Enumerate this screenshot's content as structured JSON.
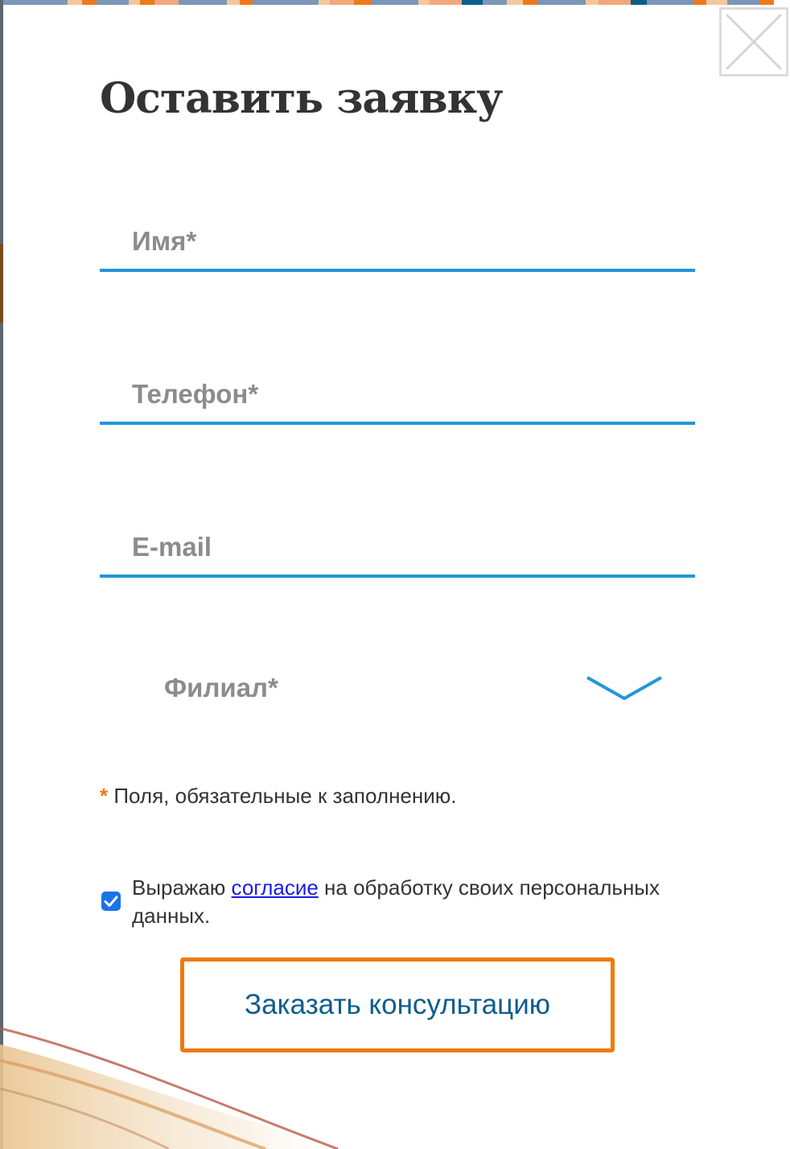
{
  "modal": {
    "title": "Оставить заявку",
    "close_icon": "close-icon",
    "accent_color": "#2196d9",
    "button_border_color": "#f07a0c"
  },
  "form": {
    "name_placeholder": "Имя*",
    "phone_placeholder": "Телефон*",
    "email_placeholder": "E-mail",
    "branch_select": {
      "label": "Филиал*",
      "icon": "chevron-down-icon"
    },
    "required_star": "*",
    "required_note": " Поля, обязательные к заполнению.",
    "consent": {
      "checked": true,
      "text_before": "Выражаю ",
      "link_text": "согласие",
      "text_after": " на обработку своих персональных данных."
    },
    "submit_label": "Заказать консультацию"
  }
}
